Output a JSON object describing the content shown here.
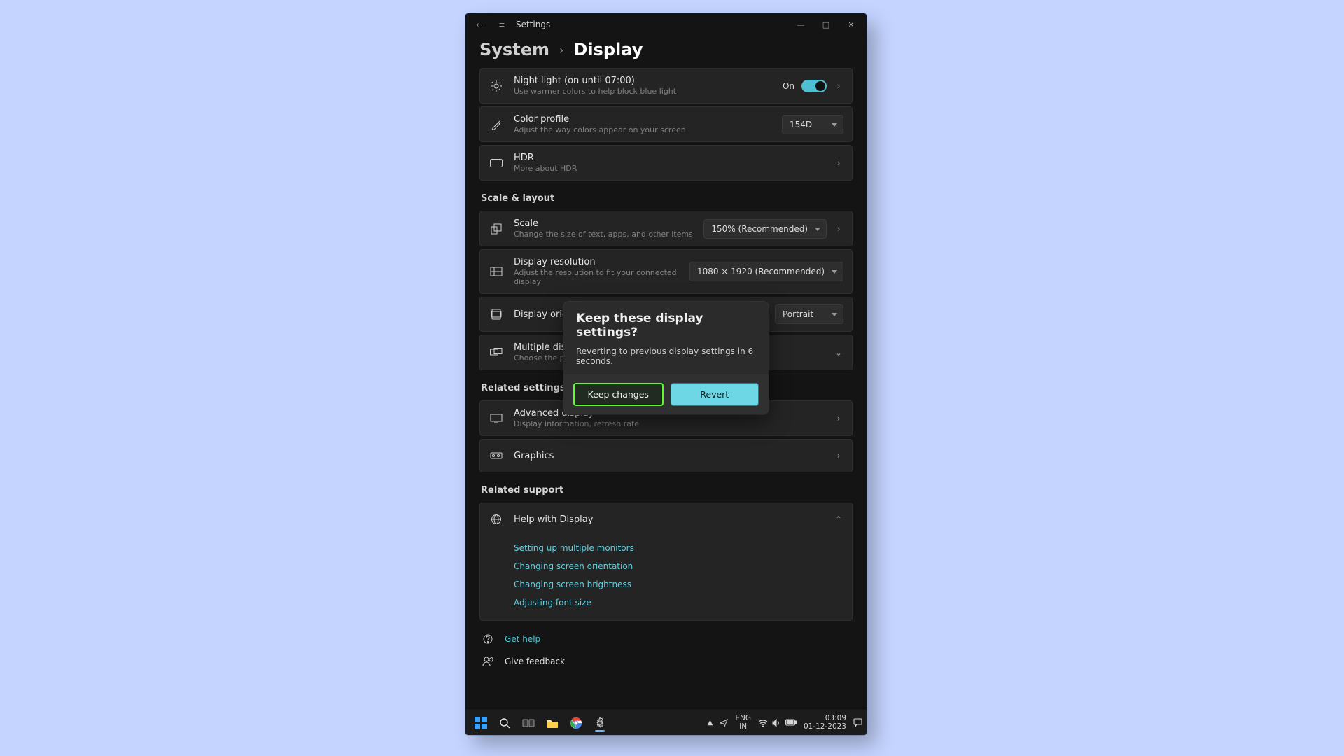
{
  "titlebar": {
    "app_name": "Settings",
    "back_glyph": "←",
    "menu_glyph": "≡",
    "min_glyph": "—",
    "max_glyph": "□",
    "close_glyph": "✕"
  },
  "breadcrumb": {
    "parent": "System",
    "separator": "›",
    "current": "Display"
  },
  "rows": {
    "night_light": {
      "title": "Night light (on until 07:00)",
      "sub": "Use warmer colors to help block blue light",
      "state": "On"
    },
    "color_profile": {
      "title": "Color profile",
      "sub": "Adjust the way colors appear on your screen",
      "value": "154D"
    },
    "hdr": {
      "title": "HDR",
      "link": "More about HDR"
    },
    "scale": {
      "title": "Scale",
      "sub": "Change the size of text, apps, and other items",
      "value": "150% (Recommended)"
    },
    "resolution": {
      "title": "Display resolution",
      "sub": "Adjust the resolution to fit your connected display",
      "value": "1080 × 1920 (Recommended)"
    },
    "orientation": {
      "title": "Display orientation",
      "value": "Portrait"
    },
    "multi": {
      "title": "Multiple displays",
      "sub": "Choose the presentation mode for your displays"
    },
    "advanced": {
      "title": "Advanced display",
      "sub": "Display information, refresh rate"
    },
    "graphics": {
      "title": "Graphics"
    },
    "help": {
      "title": "Help with Display"
    }
  },
  "sections": {
    "scale": "Scale & layout",
    "related": "Related settings",
    "support": "Related support"
  },
  "help_links": {
    "a": "Setting up multiple monitors",
    "b": "Changing screen orientation",
    "c": "Changing screen brightness",
    "d": "Adjusting font size"
  },
  "footer": {
    "get_help": "Get help",
    "feedback": "Give feedback"
  },
  "dialog": {
    "title": "Keep these display settings?",
    "msg_prefix": "Reverting to previous display settings in  ",
    "seconds": "6",
    "msg_suffix": " seconds.",
    "keep": "Keep changes",
    "revert": "Revert"
  },
  "taskbar": {
    "lang_top": "ENG",
    "lang_bot": "IN",
    "time": "03:09",
    "date": "01-12-2023"
  }
}
